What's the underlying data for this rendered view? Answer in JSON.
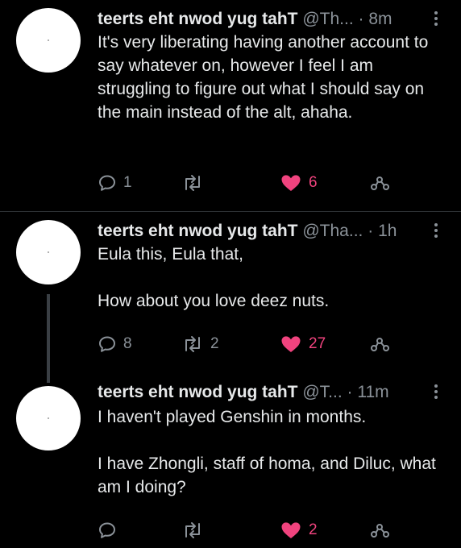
{
  "colors": {
    "background": "#000000",
    "text": "#e7e9ea",
    "secondary": "#8b9299",
    "like": "#f0437e",
    "divider": "#2f3336",
    "thread_line": "#3a3f44"
  },
  "icons": {
    "reply": "reply-icon",
    "retweet": "retweet-icon",
    "like": "heart-icon",
    "share": "share-icon",
    "more": "more-icon"
  },
  "tweets": [
    {
      "name": "teerts eht nwod yug tahT",
      "handle": "@Th...",
      "separator": "·",
      "time": "8m",
      "paragraphs": [
        "It's very liberating having another account to say whatever on, however I feel I am struggling to figure out what I should say on the main instead of the alt, ahaha."
      ],
      "replies": "1",
      "retweets": "",
      "likes": "6",
      "liked": true
    },
    {
      "name": "teerts eht nwod yug tahT",
      "handle": "@Tha...",
      "separator": "·",
      "time": "1h",
      "paragraphs": [
        "Eula this, Eula that,",
        "How about you love deez nuts."
      ],
      "replies": "8",
      "retweets": "2",
      "likes": "27",
      "liked": true
    },
    {
      "name": "teerts eht nwod yug tahT",
      "handle": "@T...",
      "separator": "·",
      "time": "11m",
      "paragraphs": [
        "I haven't played Genshin in months.",
        "I have Zhongli, staff of homa, and Diluc, what am I doing?"
      ],
      "replies": "",
      "retweets": "",
      "likes": "2",
      "liked": true
    }
  ]
}
